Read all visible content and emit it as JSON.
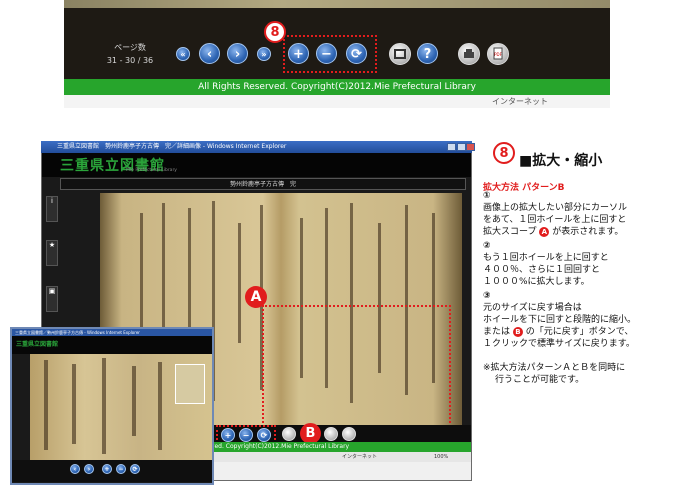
{
  "toolbar": {
    "badge_number": "8",
    "page_label": "ページ数",
    "page_count": "31 - 30 / 36",
    "copyright": "All Rights Reserved. Copyright(C)2012.Mie Prefectural Library",
    "status_fragment": "インターネット",
    "button_icons": [
      "first-page-icon",
      "prev-page-icon",
      "next-page-icon",
      "last-page-icon",
      "zoom-in-icon",
      "zoom-out-icon",
      "reset-icon",
      "fullscreen-icon",
      "help-icon",
      "print-icon",
      "pdf-icon"
    ]
  },
  "large_window": {
    "title": "三重県立図書館　勢州鈴鹿亭子方古傳　完／詳細画像 - Windows Internet Explorer",
    "logo_text": "三重県立図書館",
    "logo_sub": "Mie Prefectural Library",
    "doc_title": "勢州鈴鹿亭子方古傳　完",
    "copyright": "All Rights Reserved. Copyright(C)2012.Mie Prefectural Library",
    "status_zone": "インターネット",
    "zoom_level": "100%",
    "badge_a": "A",
    "badge_b": "B"
  },
  "small_window": {
    "title": "三重県立図書館／勢州鈴鹿亭子方古傳 - Windows Internet Explorer",
    "logo_text": "三重県立図書館"
  },
  "panel": {
    "number": "8",
    "heading": "■拡大・縮小",
    "subtitle": "拡大方法 パターンB",
    "step1": "①",
    "line1": "画像上の拡大したい部分にカーソル",
    "line2": "をあて、１回ホイールを上に回すと",
    "line3_pre": "拡大スコープ",
    "line3_badge": "A",
    "line3_post": "が表示されます。",
    "step2": "②",
    "line4": "もう１回ホイールを上に回すと",
    "line5": "４００％、さらに１回回すと",
    "line6": "１０００%に拡大します。",
    "step3": "③",
    "line7": "元のサイズに戻す場合は",
    "line8": "ホイールを下に回すと段階的に縮小。",
    "line9_pre": "または",
    "line9_badge": "B",
    "line9_post": "の「元に戻す」ボタンで、",
    "line10": "１クリックで標準サイズに戻ります。",
    "note1": "※拡大方法パターンＡとＢを同時に",
    "note2": "行うことが可能です。"
  },
  "colors": {
    "accent_red": "#e11d1d",
    "footer_green": "#27a52c",
    "button_blue": "#2d64b3"
  }
}
